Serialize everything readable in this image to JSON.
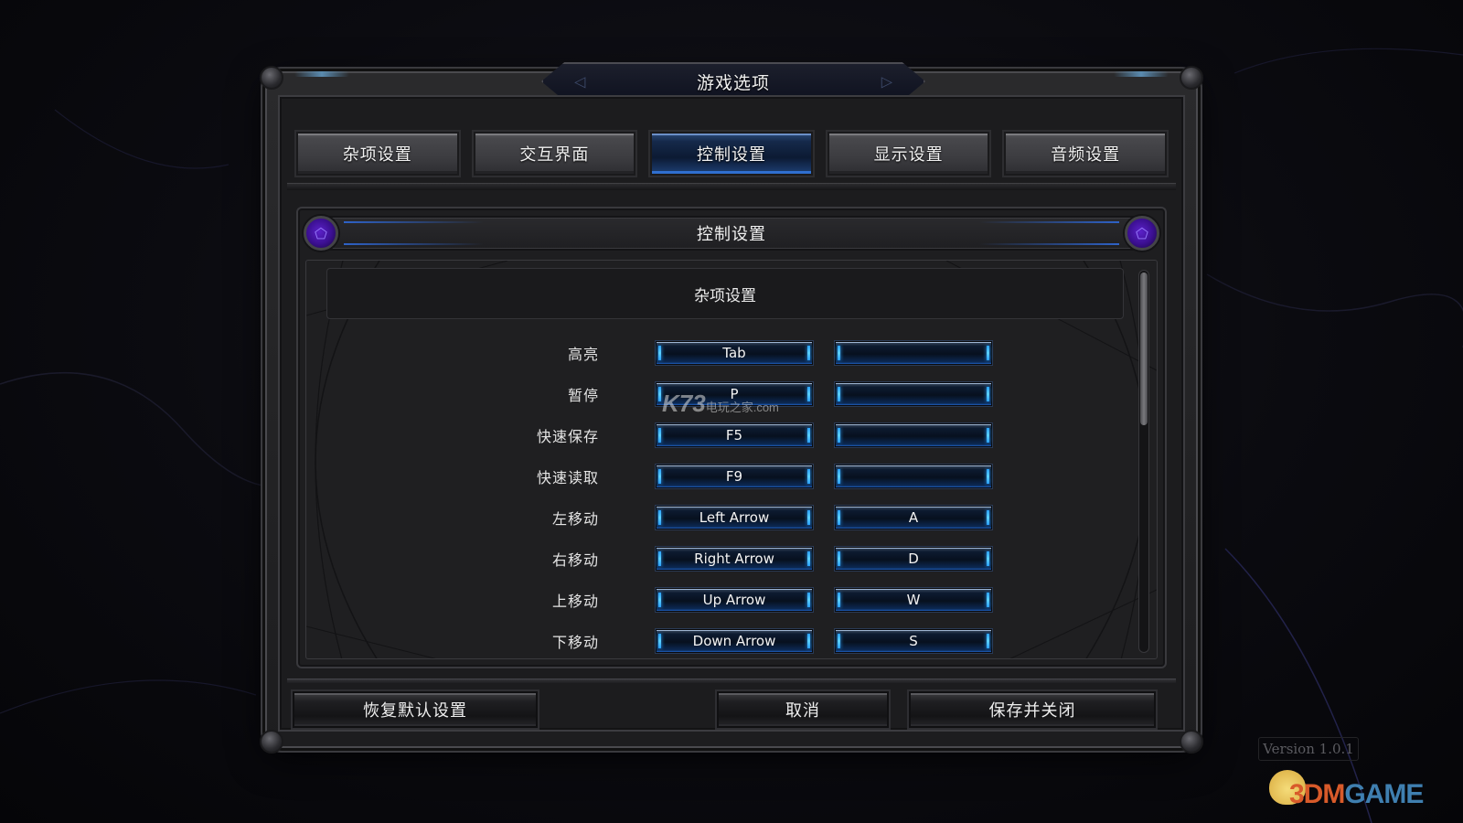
{
  "window": {
    "title": "游戏选项"
  },
  "tabs": [
    {
      "label": "杂项设置",
      "active": false
    },
    {
      "label": "交互界面",
      "active": false
    },
    {
      "label": "控制设置",
      "active": true
    },
    {
      "label": "显示设置",
      "active": false
    },
    {
      "label": "音频设置",
      "active": false
    }
  ],
  "panel": {
    "title": "控制设置",
    "group_title": "杂项设置",
    "scroll_position": 0,
    "bindings": [
      {
        "action": "高亮",
        "primary": "Tab",
        "secondary": ""
      },
      {
        "action": "暂停",
        "primary": "P",
        "secondary": ""
      },
      {
        "action": "快速保存",
        "primary": "F5",
        "secondary": ""
      },
      {
        "action": "快速读取",
        "primary": "F9",
        "secondary": ""
      },
      {
        "action": "左移动",
        "primary": "Left Arrow",
        "secondary": "A"
      },
      {
        "action": "右移动",
        "primary": "Right Arrow",
        "secondary": "D"
      },
      {
        "action": "上移动",
        "primary": "Up Arrow",
        "secondary": "W"
      },
      {
        "action": "下移动",
        "primary": "Down Arrow",
        "secondary": "S"
      }
    ]
  },
  "buttons": {
    "reset": "恢复默认设置",
    "cancel": "取消",
    "save_close": "保存并关闭"
  },
  "version": "Version 1.0.1",
  "watermarks": {
    "k73_brand": "K73",
    "k73_sub": "电玩之家",
    "k73_domain": ".com",
    "site_a": "3DM",
    "site_b": "GAME"
  },
  "colors": {
    "accent_blue": "#2e62c8",
    "key_glow": "#2aa0ff",
    "orb_purple": "#5b21c9",
    "active_tab": "#15294a"
  }
}
